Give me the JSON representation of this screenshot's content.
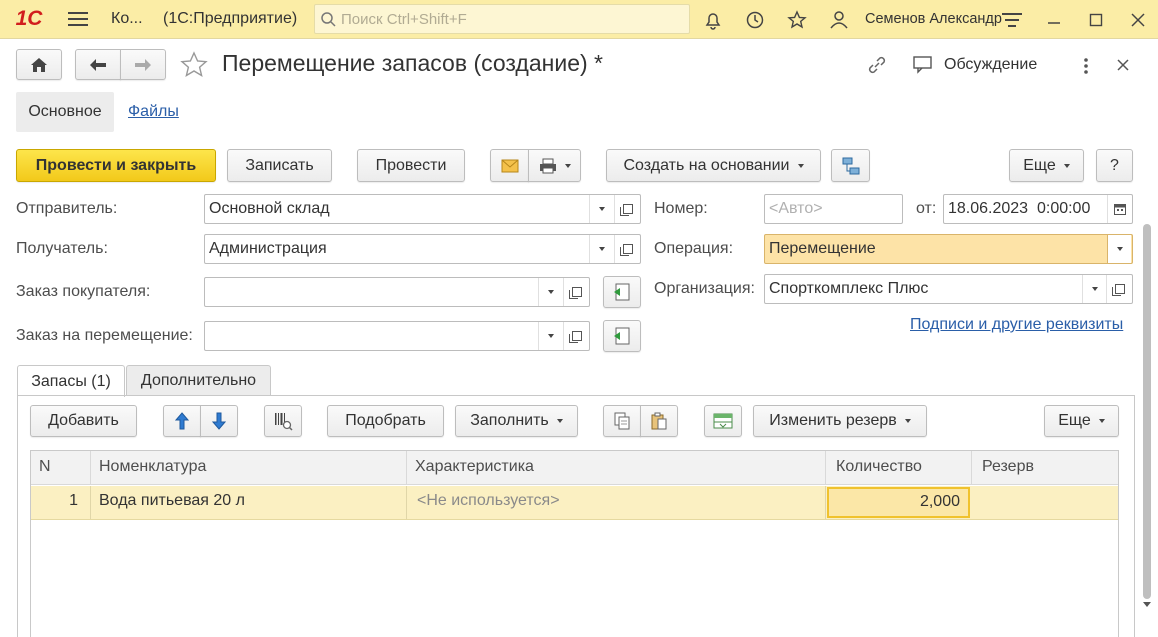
{
  "app": {
    "logo": "1С",
    "short_title": "Ко...",
    "product": "(1С:Предприятие)",
    "search_placeholder": "Поиск Ctrl+Shift+F",
    "user": "Семенов Александр"
  },
  "header": {
    "title": "Перемещение запасов (создание) *",
    "discussion": "Обсуждение"
  },
  "nav_tabs": [
    "Основное",
    "Файлы"
  ],
  "toolbar": {
    "post_close": "Провести и закрыть",
    "save": "Записать",
    "post": "Провести",
    "create_based": "Создать на основании",
    "more": "Еще",
    "help": "?"
  },
  "form": {
    "sender_label": "Отправитель:",
    "sender_value": "Основной склад",
    "receiver_label": "Получатель:",
    "receiver_value": "Администрация",
    "customer_order_label": "Заказ покупателя:",
    "customer_order_value": "",
    "transfer_order_label": "Заказ на перемещение:",
    "transfer_order_value": "",
    "number_label": "Номер:",
    "number_placeholder": "<Авто>",
    "date_label": "от:",
    "date_value": "18.06.2023  0:00:00",
    "operation_label": "Операция:",
    "operation_value": "Перемещение",
    "org_label": "Организация:",
    "org_value": "Спорткомплекс Плюс",
    "signatures_link": "Подписи и другие реквизиты"
  },
  "doc_tabs": [
    "Запасы (1)",
    "Дополнительно"
  ],
  "table_toolbar": {
    "add": "Добавить",
    "pick": "Подобрать",
    "fill": "Заполнить",
    "change_reserve": "Изменить резерв",
    "more": "Еще"
  },
  "table": {
    "columns": [
      "N",
      "Номенклатура",
      "Характеристика",
      "Количество",
      "Резерв"
    ],
    "rows": [
      {
        "n": "1",
        "item": "Вода питьевая 20 л",
        "characteristic": "<Не используется>",
        "quantity": "2,000",
        "reserve": ""
      }
    ]
  },
  "colors": {
    "titlebar": "#fbeda6",
    "primary_button": "#f5d221",
    "selected_row": "#fbf0c2",
    "link": "#2a5ea8",
    "operation_field": "#fde3a7"
  }
}
